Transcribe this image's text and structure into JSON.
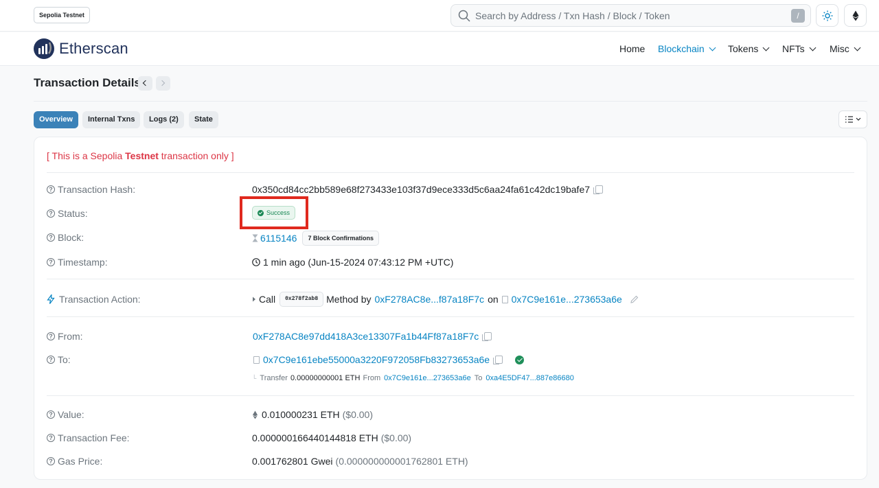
{
  "network": "Sepolia Testnet",
  "search": {
    "placeholder": "Search by Address / Txn Hash / Block / Token",
    "shortcut": "/"
  },
  "icons": {
    "search": "search-icon",
    "theme": "sun-icon",
    "network": "ethereum-icon",
    "help": "question-circle-icon",
    "copy": "copy-icon",
    "clock": "clock-icon",
    "hourglass": "hourglass-icon",
    "action": "lightning-icon",
    "edit": "pencil-icon"
  },
  "brand": {
    "name": "Etherscan",
    "color": "#21325b",
    "accent": "#0784c3"
  },
  "nav": {
    "home": "Home",
    "blockchain": "Blockchain",
    "tokens": "Tokens",
    "nfts": "NFTs",
    "misc": "Misc"
  },
  "page": {
    "title": "Transaction Details"
  },
  "tabs": {
    "overview": "Overview",
    "internal": "Internal Txns",
    "logs": "Logs (2)",
    "state": "State"
  },
  "notice": {
    "prefix": "[ This is a Sepolia ",
    "bold": "Testnet",
    "suffix": " transaction only ]"
  },
  "details": {
    "hash": {
      "label": "Transaction Hash:",
      "value": "0x350cd84cc2bb589e68f273433e103f37d9ece333d5c6aa24fa61c42dc19bafe7"
    },
    "status": {
      "label": "Status:",
      "value": "Success",
      "color": "#198754"
    },
    "block": {
      "label": "Block:",
      "number": "6115146",
      "confirmations": "7 Block Confirmations"
    },
    "timestamp": {
      "label": "Timestamp:",
      "value": "1 min ago (Jun-15-2024 07:43:12 PM +UTC)"
    },
    "action": {
      "label": "Transaction Action:",
      "call": "Call",
      "method": "0x278f2ab8",
      "method_by": "Method by",
      "by_address": "0xF278AC8e...f87a18F7c",
      "on": "on",
      "contract": "0x7C9e161e...273653a6e"
    },
    "from": {
      "label": "From:",
      "value": "0xF278AC8e97dd418A3ce13307Fa1b44Ff87a18F7c"
    },
    "to": {
      "label": "To:",
      "value": "0x7C9e161ebe55000a3220F972058Fb83273653a6e"
    },
    "transfer": {
      "prefix": "Transfer",
      "amount": "0.00000000001 ETH",
      "from_label": "From",
      "from": "0x7C9e161e...273653a6e",
      "to_label": "To",
      "to": "0xa4E5DF47...887e86680"
    },
    "value": {
      "label": "Value:",
      "amount": "0.010000231 ETH",
      "usd": "($0.00)"
    },
    "fee": {
      "label": "Transaction Fee:",
      "amount": "0.000000166440144818 ETH",
      "usd": "($0.00)"
    },
    "gas": {
      "label": "Gas Price:",
      "amount": "0.001762801 Gwei",
      "eth": "(0.000000000001762801 ETH)"
    }
  },
  "highlight": {
    "color": "#e0291e"
  }
}
